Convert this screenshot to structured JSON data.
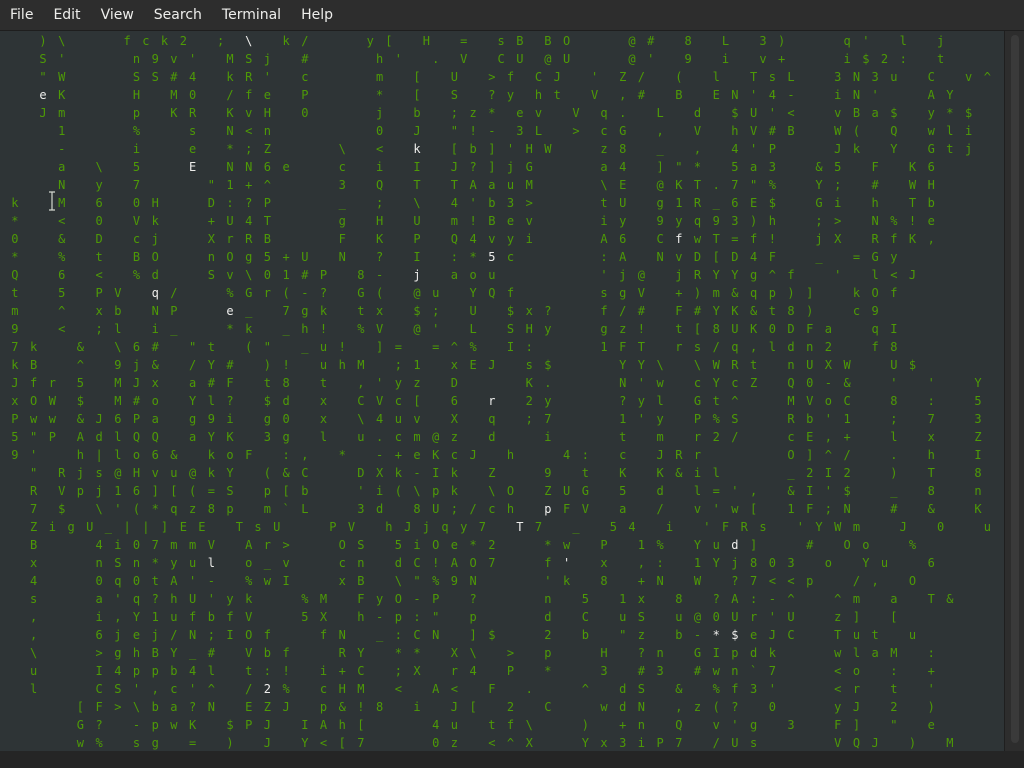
{
  "menu": {
    "items": [
      {
        "id": "file",
        "label": "File"
      },
      {
        "id": "edit",
        "label": "Edit"
      },
      {
        "id": "view",
        "label": "View"
      },
      {
        "id": "search",
        "label": "Search"
      },
      {
        "id": "terminal",
        "label": "Terminal"
      },
      {
        "id": "help",
        "label": "Help"
      }
    ]
  },
  "terminal": {
    "background": "#2e3436",
    "green": "#4e9a06",
    "bright": "#eeeeec",
    "rows": [
      "    ) \\      f c k 2   ;  \\   k /      y [   H   =   s B  B O      @ #   8   L   3 )      q '   l   j       )",
      "    S '       n 9 v '   M S j   #       h '   .  V   C U  @ U      @ '   9   i   v +      i $ 2 :   t       N",
      "    \" W       S S # 4   k R '   c       m   [   U   > f  C J   '  Z /   (   l   T s L    3 N 3 u   C   v ^",
      "    e K       H   M 0   / f e   P       *   [   S   ? y  h t   V  , #   B   E N ' 4 -    i N '     A Y",
      "    J m       p   K R   K v H   0       j   b   ; z *  e v   V  q .   L   d   $ U ' <    v B a $   y * $",
      "      1       %     s   N < n           0   J   \" ! -  3 L   >  c G   ,   V   h V # B    W (   Q   w l i",
      "      -       i     e   * ; Z       \\   <   k   [ b ] ' H W     z 8   _   ,   4 ' P      J k   Y   G t j",
      "      a   \\   5     E   N N 6 e     c   i   I   J ? ] j G       a 4   ] \" *   5 a 3    & 5   F   K 6",
      "      N   y   7       \" 1 + ^       3   Q   T   T A a u M       \\ E   @ K T . 7 \" %    Y ;   #   W H",
      " k    M   6   0 H     D : ? P       _   ;   \\   4 ' b 3 >       t U   g 1 R _ 6 E $    G i   h   T b",
      " *    <   0   V k     + U 4 T       g   H   U   m ! B e v       i y   9 y q 9 3 ) h    ; >   N % ! e",
      " 0    &   D   c j     X r R B       F   K   P   Q 4 v y i       A 6   C f w T = f !    j X   R f K ,",
      " *    %   t   B O     n O g 5 + U   N   ?   I   : * 5 c         : A   N v D [ D 4 F    _   = G y",
      " Q    6   <   % d     S v \\ 0 1 # P   8 -   j   a o u           ' j @   j R Y Y g ^ f    '   l < J",
      " t    5   P V   q /     % G r ( - ?   G (   @ u   Y Q f         s g V   + ) m & q p ) ]    k O f",
      " m    ^   x b   N P     e _   7 g k   t x   $ ;   U   $ x ?     f / #   F # Y K & t 8 )    c 9",
      " 9    <   ; l   i _     * k   _ h !   % V   @ '   L   S H y     g z !   t [ 8 U K 0 D F a    q I",
      " 7 k    &   \\ 6 #   \" t   ( \"   _ u !   ] =   = ^ %   I :       1 F T   r s / q , l d n 2    f 8",
      " k B    ^   9 j &   / Y #   ) !   u h M   ; 1   x E J   s $       Y Y \\   \\ W R t   n U X W    U $",
      " J f r  5   M J x   a # F   t 8   t   , ' y z   D       K .       N ' w   c Y c Z   Q 0 - &    '   '    Y",
      " x O W  $   M # o   Y l ?   $ d   x   C V c [   6   r   2 y       ? y l   G t ^     M V o C    8   :    5",
      " P w w  & J 6 P a   g 9 i   g 0   x   \\ 4 u v   X   q   ; 7       1 ' y   P % S     R b ' 1    ;   7    3",
      " 5 \" P  A d l Q Q   a Y K   3 g   l   u . c m @ z   d     i       t   m   r 2 /     c E , +    l   x    Z",
      " 9 '    h | l o 6 &   k o F   : ,   *   - + e K c J   h     4 :   c   J R r         O ] ^ /    .   h    I",
      "   \"  R j s @ H v u @ k Y   ( & C     D X k - I k   Z     9   t   K   K & i l       _ 2 I 2    )   T    8",
      "   R  V p j 1 6 ] [ ( = S   p [ b     ' i ( \\ p k   \\ O   Z U G   5   d   l = ' ,   & I ' $    _   8    n",
      "   7  $   \\ ' ( * q z 8 p   m ` L     3 d   8 U ; / c h   p F V   a   /   v ' w [   1 F ; N    #   &    K",
      "   Z i g U _ | | ] E E   T s U     P V   h J j q y 7   T 7   _   5 4   i   ' F R s   ' Y W m    J   0    u",
      "   B      4 i 0 7 m m V   A r >     O S   5 i O e * 2     * w   P   1 %   Y u d ]     #   O o    %",
      "   x      n S n * y u l   o _ v     c n   d C ! A O 7     f '   x   , :   1 Y j 8 0 3   o   Y u    6",
      "   4      0 q 0 t A ' -   % w I     x B   \\ \" % 9 N       ' k   8   + N   W   ? 7 < < p    / ,   O",
      "   s      a ' q ? h U ' y k     % M   F y O - P   ?       n   5   1 x   8   ? A : - ^    ^ m   a   T &",
      "   ,      i , Y 1 u f b f V     5 X   h - p : \"   p       d   C   u S   u @ 0 U r ' U    z ]   [",
      "   ,      6 j e j / N ; I O f     f N   _ : C N   ] $     2   b   \" z   b - * $ e J C    T u t   u",
      "   \\      > g h B Y _ #   V b f     R Y   * *   X \\   >   p     H   ? n   G I p d k      w l a M   :",
      "   u      I 4 p p b 4 l   t : !   i + C   ; X   r 4   P   *     3   # 3   # w n ` 7      < o   :   +",
      "   l      C S ' , c ' ^   / 2 %   c H M   <   A <   F   .     ^   d S   &   % f 3 '      < r   t   '",
      "        [ F > \\ b a ? N   E Z J   p & ! 8   i   J [   2   C     w d N   , z ( ?   0      y J   2   )",
      "        G ?   - p w K   $ P J   I A h [       4 u   t f \\     )   + n   Q   v ' g   3    F ]   \"   e",
      "        w %   s g   =   )   J   Y < [ 7       0 z   < ^ X     Y x 3 i P 7   / U s        V Q J   )   M"
    ]
  }
}
